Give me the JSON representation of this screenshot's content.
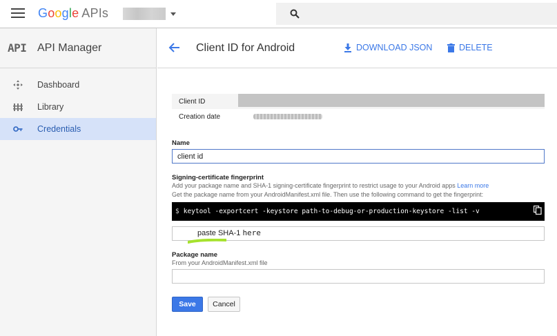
{
  "header": {
    "logo_google": "Google",
    "logo_apis": "APIs"
  },
  "sidebar": {
    "badge": "API",
    "title": "API Manager",
    "items": [
      {
        "label": "Dashboard",
        "icon": "dashboard-icon"
      },
      {
        "label": "Library",
        "icon": "library-icon"
      },
      {
        "label": "Credentials",
        "icon": "key-icon",
        "active": true
      }
    ]
  },
  "page": {
    "title": "Client ID for Android",
    "download_label": "DOWNLOAD JSON",
    "delete_label": "DELETE"
  },
  "info": {
    "client_id_label": "Client ID",
    "creation_date_label": "Creation date"
  },
  "form": {
    "name_label": "Name",
    "name_value": "client id",
    "fingerprint_label": "Signing-certificate fingerprint",
    "fingerprint_desc": "Add your package name and SHA-1 signing-certificate fingerprint to restrict usage to your Android apps",
    "learn_more": "Learn more",
    "fingerprint_desc2": "Get the package name from your AndroidManifest.xml file. Then use the following command to get the fingerprint:",
    "command_prompt": "$",
    "command": "keytool -exportcert -keystore path-to-debug-or-production-keystore -list -v",
    "sha_note_prefix": "paste SHA-1",
    "sha_note_suffix": "here",
    "sha_value": "",
    "package_label": "Package name",
    "package_desc": "From your AndroidManifest.xml file",
    "package_value": "",
    "save_label": "Save",
    "cancel_label": "Cancel"
  },
  "colors": {
    "accent": "#3b78e7",
    "active_bg": "#d6e2f9",
    "highlight": "#a6e22e"
  }
}
